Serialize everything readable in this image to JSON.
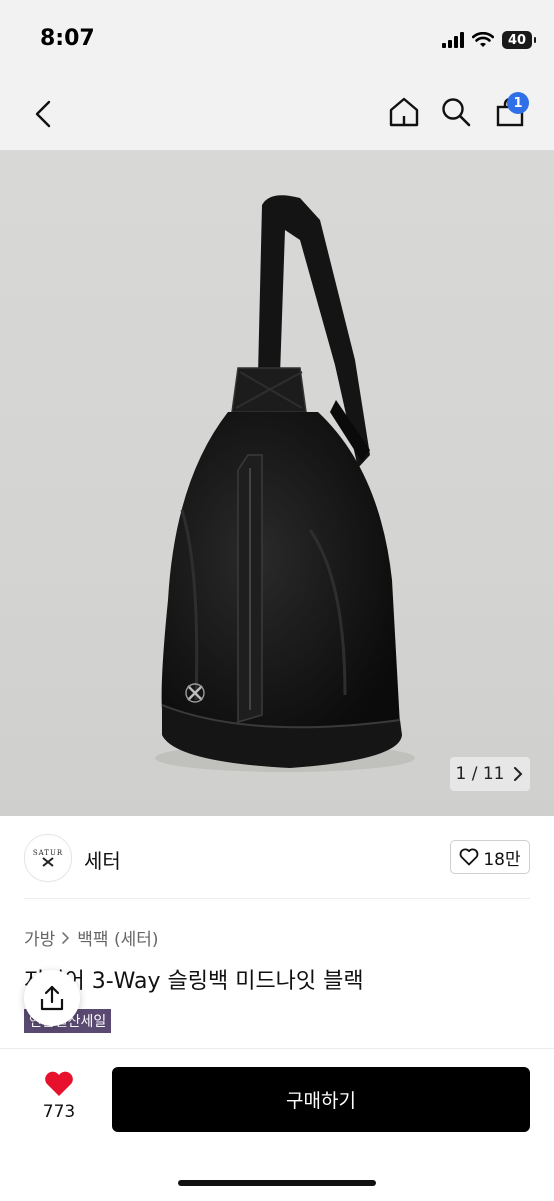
{
  "status_bar": {
    "time": "8:07",
    "battery": "40"
  },
  "header": {
    "back_icon": "chevron-left-icon",
    "home_icon": "home-icon",
    "search_icon": "search-icon",
    "cart_icon": "shopping-bag-icon",
    "cart_badge": "1",
    "badge_color": "#2f6fe8"
  },
  "gallery": {
    "counter": "1 / 11"
  },
  "brand": {
    "logo_text": "SATUR",
    "name": "세터",
    "like_count": "18만"
  },
  "product": {
    "breadcrumb": [
      "가방",
      "백팩 (세터)"
    ],
    "title": "저니어 3-Way 슬링백 미드나잇 블랙",
    "badge": "연말결산세일",
    "badge_color": "#5a4a72"
  },
  "bottom_bar": {
    "wish_count": "773",
    "buy_label": "구매하기",
    "heart_color": "#e8112d"
  }
}
